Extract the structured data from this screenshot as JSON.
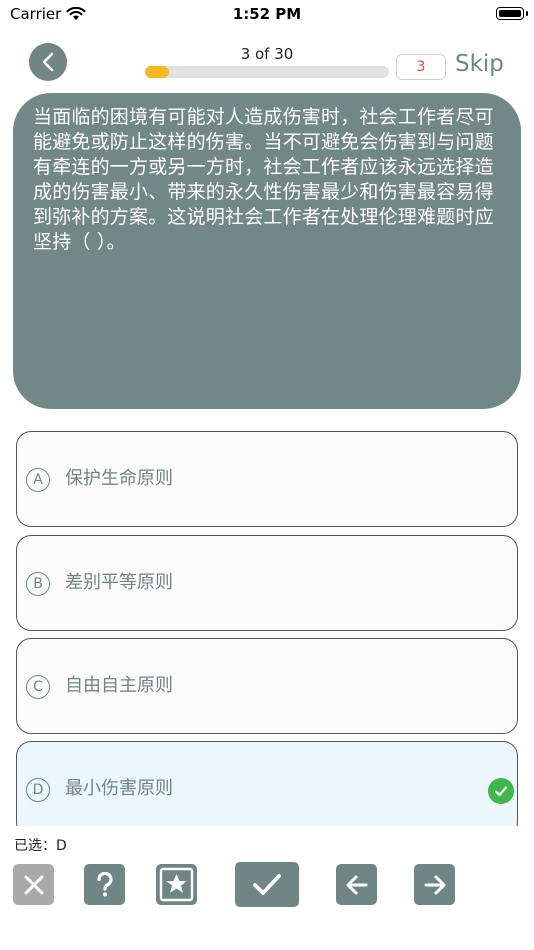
{
  "status_bar": {
    "carrier": "Carrier",
    "time": "1:52 PM"
  },
  "header": {
    "progress_label": "3 of 30",
    "progress_fraction": 0.1,
    "counter": "3",
    "skip_label": "Skip"
  },
  "question": {
    "text": "当面临的困境有可能对人造成伤害时，社会工作者尽可能避免或防止这样的伤害。当不可避免会伤害到与问题有牵连的一方或另一方时，社会工作者应该永远选择造成的伤害最小、带来的永久性伤害最少和伤害最容易得到弥补的方案。这说明社会工作者在处理伦理难题时应坚持（ ）。"
  },
  "options": [
    {
      "letter": "A",
      "text": "保护生命原则"
    },
    {
      "letter": "B",
      "text": "差别平等原则"
    },
    {
      "letter": "C",
      "text": "自由自主原则"
    },
    {
      "letter": "D",
      "text": "最小伤害原则"
    }
  ],
  "selected_answer": {
    "text": "已选：D"
  },
  "toolbar": {
    "buttons": [
      "close-icon",
      "question-icon",
      "star-icon",
      "checkmark-icon",
      "arrow-left-icon",
      "arrow-right-icon"
    ]
  },
  "colors": {
    "accent": "#6f8685",
    "progress": "#f5b921",
    "counter": "#e0463a",
    "correct": "#3fb84b",
    "selected_bg": "#ecf7fd"
  }
}
